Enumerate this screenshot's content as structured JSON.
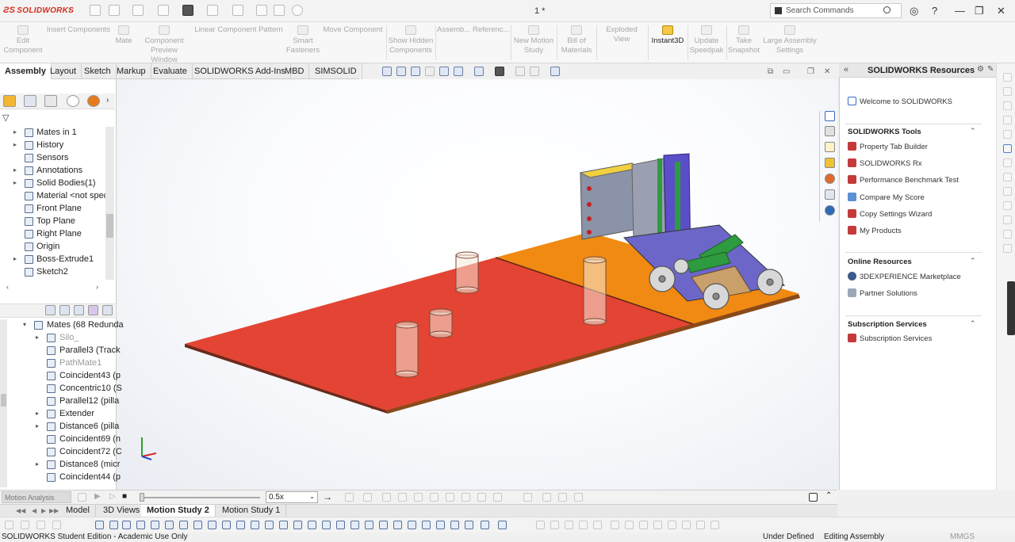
{
  "app": {
    "brand": "SOLIDWORKS",
    "brand_color": "#d52b1e",
    "document_title": "1 *"
  },
  "search": {
    "placeholder": "Search Commands"
  },
  "command_manager": [
    {
      "label": "Edit Component",
      "enabled": false
    },
    {
      "label": "Insert Components",
      "enabled": false
    },
    {
      "label": "Mate",
      "enabled": false
    },
    {
      "label": "Component Preview Window",
      "enabled": false
    },
    {
      "label": "Linear Component Pattern",
      "enabled": false
    },
    {
      "label": "Smart Fasteners",
      "enabled": false
    },
    {
      "label": "Move Component",
      "enabled": false
    },
    {
      "label": "Show Hidden Components",
      "enabled": false
    },
    {
      "label": "Assemb...",
      "enabled": false
    },
    {
      "label": "Referenc...",
      "enabled": false
    },
    {
      "label": "New Motion Study",
      "enabled": false
    },
    {
      "label": "Bill of Materials",
      "enabled": false
    },
    {
      "label": "Exploded View",
      "enabled": false
    },
    {
      "label": "Instant3D",
      "enabled": true
    },
    {
      "label": "Update Speedpak",
      "enabled": false
    },
    {
      "label": "Take Snapshot",
      "enabled": false
    },
    {
      "label": "Large Assembly Settings",
      "enabled": false
    }
  ],
  "ribbon_tabs": [
    "Assembly",
    "Layout",
    "Sketch",
    "Markup",
    "Evaluate",
    "SOLIDWORKS Add-Ins",
    "MBD",
    "SIMSOLID"
  ],
  "active_ribbon_tab": "Assembly",
  "feature_tree": [
    {
      "label": "Mates in 1",
      "icon": "mates-icon",
      "expandable": true
    },
    {
      "label": "History",
      "icon": "history-icon",
      "expandable": true
    },
    {
      "label": "Sensors",
      "icon": "sensors-icon",
      "expandable": false
    },
    {
      "label": "Annotations",
      "icon": "annotations-icon",
      "expandable": true
    },
    {
      "label": "Solid Bodies(1)",
      "icon": "solid-bodies-icon",
      "expandable": true
    },
    {
      "label": "Material <not speci",
      "icon": "material-icon",
      "expandable": false
    },
    {
      "label": "Front Plane",
      "icon": "plane-icon",
      "expandable": false
    },
    {
      "label": "Top Plane",
      "icon": "plane-icon",
      "expandable": false
    },
    {
      "label": "Right Plane",
      "icon": "plane-icon",
      "expandable": false
    },
    {
      "label": "Origin",
      "icon": "origin-icon",
      "expandable": false
    },
    {
      "label": "Boss-Extrude1",
      "icon": "extrude-icon",
      "expandable": true
    },
    {
      "label": "Sketch2",
      "icon": "sketch-icon",
      "expandable": false
    }
  ],
  "motion_tree": [
    {
      "label": "Mates (68 Redunda",
      "icon": "mates-icon",
      "level": 0,
      "expandable": true,
      "gray": false
    },
    {
      "label": "Silo_",
      "icon": "folder-icon",
      "level": 1,
      "expandable": true,
      "gray": true
    },
    {
      "label": "Parallel3 (Track",
      "icon": "parallel-icon",
      "level": 1,
      "expandable": false,
      "gray": false
    },
    {
      "label": "PathMate1",
      "icon": "pathmate-icon",
      "level": 1,
      "expandable": false,
      "gray": true
    },
    {
      "label": "Coincident43 (p",
      "icon": "coincident-icon",
      "level": 1,
      "expandable": false,
      "gray": false
    },
    {
      "label": "Concentric10 (S",
      "icon": "concentric-icon",
      "level": 1,
      "expandable": false,
      "gray": false
    },
    {
      "label": "Parallel12 (pilla",
      "icon": "parallel-icon",
      "level": 1,
      "expandable": false,
      "gray": false
    },
    {
      "label": "Extender",
      "icon": "folder-icon",
      "level": 1,
      "expandable": true,
      "gray": false
    },
    {
      "label": "Distance6 (pilla",
      "icon": "distance-icon",
      "level": 1,
      "expandable": true,
      "gray": false
    },
    {
      "label": "Coincident69 (n",
      "icon": "coincident-icon",
      "level": 1,
      "expandable": false,
      "gray": false
    },
    {
      "label": "Coincident72 (C",
      "icon": "coincident-icon",
      "level": 1,
      "expandable": false,
      "gray": false
    },
    {
      "label": "Distance8 (micr",
      "icon": "distance-icon",
      "level": 1,
      "expandable": true,
      "gray": false
    },
    {
      "label": "Coincident44 (p",
      "icon": "coincident-icon",
      "level": 1,
      "expandable": false,
      "gray": false
    }
  ],
  "task_pane": {
    "title": "SOLIDWORKS Resources",
    "welcome": "Welcome to SOLIDWORKS",
    "sections": [
      {
        "title": "SOLIDWORKS Tools",
        "items": [
          "Property Tab Builder",
          "SOLIDWORKS Rx",
          "Performance Benchmark Test",
          "Compare My Score",
          "Copy Settings Wizard",
          "My Products"
        ]
      },
      {
        "title": "Online Resources",
        "items": [
          "3DEXPERIENCE Marketplace",
          "Partner Solutions"
        ]
      },
      {
        "title": "Subscription Services",
        "items": [
          "Subscription Services"
        ]
      }
    ]
  },
  "motion": {
    "analysis_type": "Motion Analysis",
    "speed": "0.5x"
  },
  "bottom_tabs": [
    "Model",
    "3D Views",
    "Motion Study 2",
    "Motion Study 1"
  ],
  "active_bottom_tab": "Motion Study 2",
  "status": {
    "edition": "SOLIDWORKS Student Edition - Academic Use Only",
    "state": "Under Defined",
    "mode": "Editing Assembly",
    "units": "MMGS"
  },
  "colors": {
    "board_red": "#e34433",
    "board_orange": "#f08a12",
    "robot_purple": "#5a4fc8",
    "robot_green": "#2e9b3e"
  }
}
